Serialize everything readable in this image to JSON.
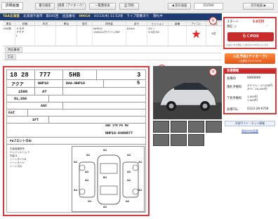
{
  "header": {
    "title": "詳細画面"
  },
  "toolbar": {
    "number_search": "番号検索",
    "same_model_search": "相場（アイオーク）",
    "same_type_search": "一覧簡易表",
    "print": "印刷"
  },
  "pager": {
    "prev": "前の画面",
    "page": "15/500",
    "next": "次の画面"
  },
  "info_strip": {
    "venue": "TAA北海道",
    "venue_detail": "北海道千歳市　第645回",
    "lot_label": "出品番号",
    "lot_no": "00018",
    "datetime": "01/13(木) 11:52頃",
    "live_status": "ライブ開催あり",
    "status2": "落札中"
  },
  "grid": {
    "headers": [
      "車名",
      "評価",
      "年式",
      "車台",
      "型式",
      "排気量",
      "走行",
      "ミッション",
      "装備",
      "アイコン",
      "評価点"
    ],
    "row": {
      "maker": "トヨタ",
      "model": "アクア",
      "grade": "L",
      "year": "H28年",
      "chassis": "NHP10",
      "engine": "1500cc/ガソリン/FAT",
      "mileage": "81Km",
      "color": "ｼﾙﾊﾞｰ",
      "shift": "3.5点 DC",
      "mark": "★",
      "score": "6点"
    }
  },
  "labels": {
    "special": "特記事項",
    "remarks": "訂正"
  },
  "sheet": {
    "year_a": "18",
    "year_b": "28",
    "lot_a": "777",
    "lot_b": "5HB",
    "grade_a": "3",
    "grade_b": "5",
    "model": "アクア",
    "chassis": "NHP10",
    "type": "DAA-NHP10",
    "plate": "1500",
    "shift": "AT",
    "mileage": "81,260",
    "aircon": "AAC",
    "door": "FAT",
    "displacement": "1FT",
    "serial": "NHP10-6489877",
    "equip": "ABS 1TM PS PW",
    "front_note": "FWフロントのみ",
    "checklist": [
      "外装傷補修有",
      "エンジンルーム 5",
      "内装 B",
      "シートタイヤB",
      "シートタイヤ",
      "シート汚れ"
    ],
    "diag_codes": [
      "A1",
      "A1",
      "A1",
      "A1",
      "A1",
      "B1",
      "A1",
      "A1",
      "U1",
      "A1",
      "A1",
      "A1",
      "A1",
      "A1",
      "A1"
    ]
  },
  "markers": {
    "one": "①",
    "two": "②",
    "three": "③"
  },
  "price": {
    "start_label": "スタート",
    "start_value": "5.0万円",
    "current_label": "現在 ン",
    "current_value": "-",
    "note": "※当社入札が発生した場合は3,000円となります"
  },
  "buttons": {
    "rakupos": "らくPOS",
    "bid": "入札予約(アイオーク)",
    "bid_sub": "入札締切 01/13 10:50"
  },
  "venue_info": {
    "title": "会場情報",
    "member_label": "会場ID",
    "member_value": "9999999",
    "fee_label": "落札手数料",
    "fee_value": "デイトレ：17,500円",
    "fee_value2": "ｽﾏｰﾄ：20,000円",
    "send_label": "下見手数料",
    "send_value": "1,000円",
    "send_value2": "1,000円",
    "tel_label": "会場TEL",
    "tel_value": "0123-28-6700"
  },
  "ext": {
    "title": "外部サイト・ネット情報",
    "link": "過去の出品歴"
  },
  "thumbs": {
    "count": "7"
  }
}
